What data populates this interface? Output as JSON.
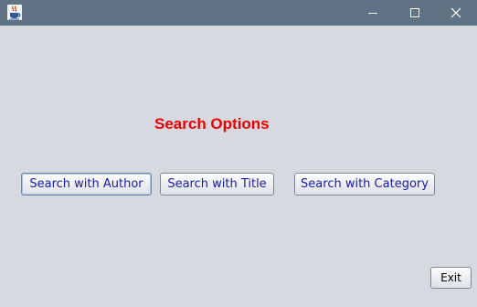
{
  "window": {
    "icon": "java-cup-icon",
    "controls": {
      "minimize": "minimize-icon",
      "maximize": "maximize-icon",
      "close": "close-icon"
    },
    "colors": {
      "titlebar": "#5f7385",
      "background": "#d6d9df"
    }
  },
  "main": {
    "heading": "Search Options",
    "heading_color": "#ee0000",
    "buttons": {
      "author": "Search with Author",
      "title": "Search with Title",
      "category": "Search with Category"
    },
    "button_text_color": "#1a1aa8"
  },
  "footer": {
    "exit": "Exit"
  }
}
